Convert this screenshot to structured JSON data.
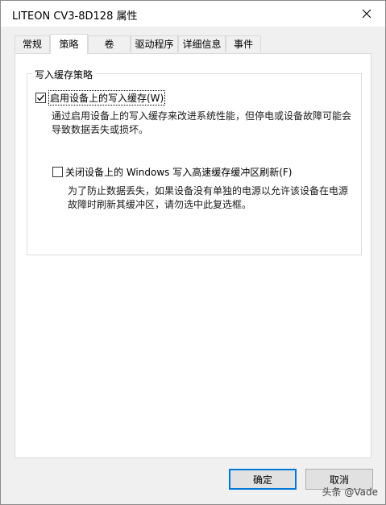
{
  "window": {
    "title": "LITEON CV3-8D128 属性"
  },
  "tabs": [
    {
      "label": "常规"
    },
    {
      "label": "策略"
    },
    {
      "label": "卷"
    },
    {
      "label": "驱动程序"
    },
    {
      "label": "详细信息"
    },
    {
      "label": "事件"
    }
  ],
  "policy": {
    "group_title": "写入缓存策略",
    "enable_cache": {
      "label": "启用设备上的写入缓存(W)",
      "checked": true,
      "description": "通过启用设备上的写入缓存来改进系统性能，但停电或设备故障可能会导致数据丢失或损坏。"
    },
    "disable_flush": {
      "label": "关闭设备上的 Windows 写入高速缓存缓冲区刷新(F)",
      "checked": false,
      "description": "为了防止数据丢失，如果设备没有单独的电源以允许该设备在电源故障时刷新其缓冲区，请勿选中此复选框。"
    }
  },
  "buttons": {
    "ok": "确定",
    "cancel": "取消"
  },
  "watermark": "头条 @Vade",
  "colors": {
    "accent": "#0078d7"
  }
}
